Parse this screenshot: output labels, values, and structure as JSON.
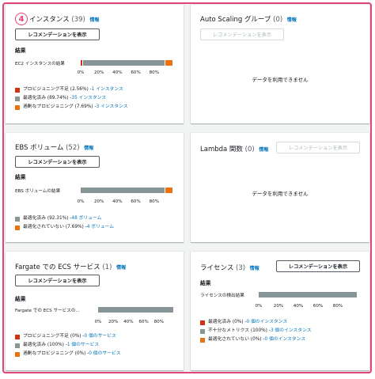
{
  "step_badge": "4",
  "colors": {
    "red": "#d13212",
    "gray": "#879596",
    "orange": "#ec7211",
    "link": "#0073bb",
    "frame": "#e0457b"
  },
  "ticks": [
    "0%",
    "20%",
    "40%",
    "60%",
    "80%"
  ],
  "ec2": {
    "title": "インスタンス",
    "count": "(39)",
    "info": "情報",
    "button": "レコメンデーションを表示",
    "section": "結果",
    "bar_label": "EC2 インスタンスの結果",
    "bar_values": [
      2.56,
      89.74,
      7.69
    ],
    "legend": [
      {
        "text": "プロビジョニング不足 (2.56%) - ",
        "link": "1 インスタンス",
        "color": "#d13212"
      },
      {
        "text": "最適化済み (89.74%) - ",
        "link": "35 インスタンス",
        "color": "#879596"
      },
      {
        "text": "過剰なプロビジョニング (7.69%) - ",
        "link": "3 インスタンス",
        "color": "#ec7211"
      }
    ]
  },
  "asg": {
    "title": "Auto Scaling グループ",
    "count": "(0)",
    "info": "情報",
    "button": "レコメンデーションを表示",
    "nodata": "データを利用できません"
  },
  "ebs": {
    "title": "EBS ボリューム",
    "count": "(52)",
    "info": "情報",
    "button": "レコメンデーションを表示",
    "section": "結果",
    "bar_label": "EBS ボリュームの結果",
    "bar_values": [
      92.31,
      7.69
    ],
    "legend": [
      {
        "text": "最適化済み (92.31%) - ",
        "link": "48 ボリューム",
        "color": "#879596"
      },
      {
        "text": "最適化されていない (7.69%) - ",
        "link": "4 ボリューム",
        "color": "#ec7211"
      }
    ]
  },
  "lambda": {
    "title": "Lambda 関数",
    "count": "(0)",
    "info": "情報",
    "button": "レコメンデーションを表示",
    "nodata": "データを利用できません"
  },
  "fargate": {
    "title": "Fargate での ECS サービス",
    "count": "(1)",
    "info": "情報",
    "button": "レコメンデーションを表示",
    "section": "結果",
    "bar_label": "Fargate での ECS サービスの...",
    "bar_values": [
      0,
      100,
      0
    ],
    "legend": [
      {
        "text": "プロビジョニング不足 (0%) - ",
        "link": "0 個のサービス",
        "color": "#d13212"
      },
      {
        "text": "最適化済み (100%) - ",
        "link": "1 個のサービス",
        "color": "#879596"
      },
      {
        "text": "過剰なプロビジョニング (0%) - ",
        "link": "0 個のサービス",
        "color": "#ec7211"
      }
    ]
  },
  "license": {
    "title": "ライセンス",
    "count": "(3)",
    "info": "情報",
    "button": "レコメンデーションを表示",
    "section": "結果",
    "bar_label": "ライセンスの検出結果",
    "bar_values": [
      0,
      100,
      0
    ],
    "legend": [
      {
        "text": "最適化済み (0%) - ",
        "link": "0 個のインスタンス",
        "color": "#d13212"
      },
      {
        "text": "不十分なメトリクス (100%) - ",
        "link": "3 個のインスタンス",
        "color": "#879596"
      },
      {
        "text": "最適化されていない (0%) - ",
        "link": "0 個のインスタンス",
        "color": "#ec7211"
      }
    ]
  }
}
